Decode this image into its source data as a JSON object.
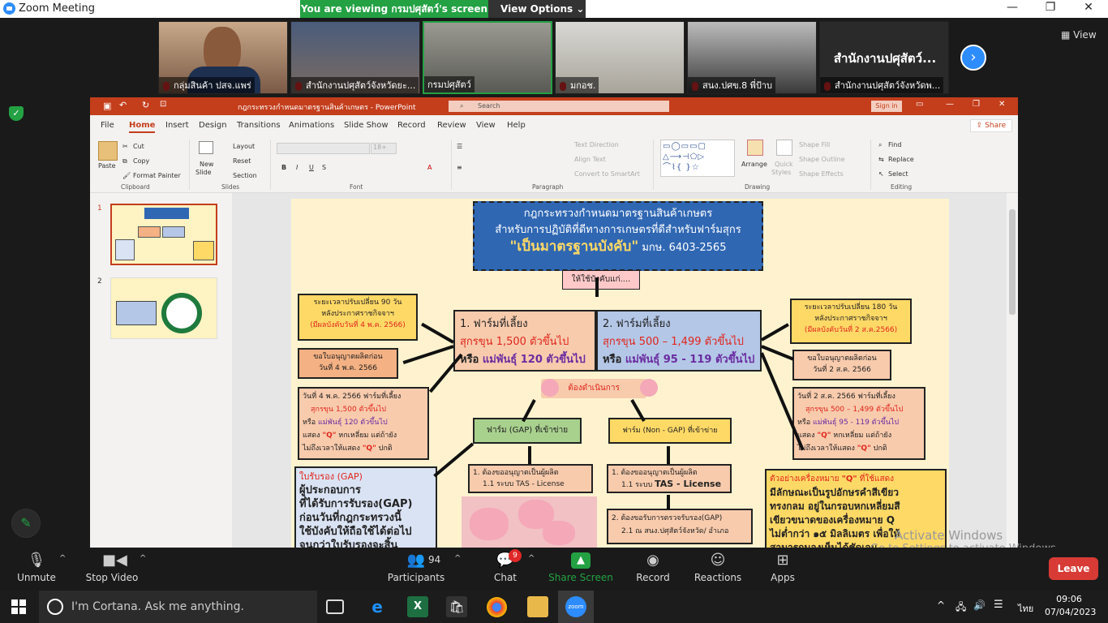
{
  "titlebar": {
    "title": "Zoom Meeting",
    "minimize": "—",
    "restore": "❐",
    "close": "✕"
  },
  "share_banner": {
    "viewing": "You are viewing กรมปศุสัตว์'s screen",
    "view_options": "View Options ⌄"
  },
  "gallery": {
    "participants": [
      {
        "name": "กลุ่มสินค้า ปสจ.แพร่"
      },
      {
        "name": "สำนักงานปศุสัตว์จังหวัดยะ..."
      },
      {
        "name": "กรมปศุสัตว์"
      },
      {
        "name": "มกอช."
      },
      {
        "name": "สนง.ปศข.8 พี่ป้าบ"
      },
      {
        "name": "สำนักงานปศุสัตว์จังหวัดพ..."
      }
    ],
    "big_name": "สำนักงานปศุสัตว์...",
    "view_label": "View",
    "next_icon": "›"
  },
  "ppt": {
    "doc_title": "กฎกระทรวงกำหนดมาตรฐานสินค้าเกษตร - PowerPoint",
    "search_placeholder": "Search",
    "sign_in": "Sign in",
    "tabs": [
      "File",
      "Home",
      "Insert",
      "Design",
      "Transitions",
      "Animations",
      "Slide Show",
      "Record",
      "Review",
      "View",
      "Help"
    ],
    "share": "Share",
    "ribbon": {
      "clipboard": {
        "paste": "Paste",
        "cut": "Cut",
        "copy": "Copy",
        "format_painter": "Format Painter",
        "label": "Clipboard"
      },
      "slides": {
        "new_slide": "New",
        "new_slide2": "Slide",
        "layout": "Layout",
        "reset": "Reset",
        "section": "Section",
        "label": "Slides"
      },
      "font": {
        "label": "Font",
        "size": "18+"
      },
      "paragraph": {
        "text_direction": "Text Direction",
        "align_text": "Align Text",
        "smartart": "Convert to SmartArt",
        "label": "Paragraph"
      },
      "drawing": {
        "arrange": "Arrange",
        "quick_styles": "Quick",
        "quick_styles2": "Styles",
        "shape_fill": "Shape Fill",
        "shape_outline": "Shape Outline",
        "shape_effects": "Shape Effects",
        "label": "Drawing"
      },
      "editing": {
        "find": "Find",
        "replace": "Replace",
        "select": "Select",
        "label": "Editing"
      }
    },
    "slide_numbers": [
      "1",
      "2"
    ]
  },
  "slide": {
    "title_l1": "กฎกระทรวงกำหนดมาตรฐานสินค้าเกษตร",
    "title_l2": "สำหรับการปฏิบัติที่ดีทางการเกษตรที่ดีสำหรับฟาร์มสุกร",
    "title_l3": "\"เป็นมาตรฐานบังคับ\"",
    "title_l3b": "มกษ. 6403-2565",
    "oblige": "ให้ใช้บังคับแก่....",
    "left_note1_l1": "ระยะเวลาปรับเปลี่ยน 90 วัน",
    "left_note1_l2": "หลังประกาศราชกิจจาฯ",
    "left_note1_l3": "(มีผลบังคับวันที่ 4 พ.ค. 2566)",
    "left_note2_l1": "ขอใบอนุญาตผลิตก่อน",
    "left_note2_l2": "วันที่ 4 พ.ค. 2566",
    "farm1_l1": "1. ฟาร์มที่เลี้ยง",
    "farm1_l2a": "สุกรขุน ",
    "farm1_l2b": "1,500 ตัวขึ้นไป",
    "farm1_l3a": "หรือ ",
    "farm1_l3b": "แม่พันธุ์ 120 ตัวขึ้นไป",
    "farm2_l1": "2. ฟาร์มที่เลี้ยง",
    "farm2_l2a": "สุกรขุน ",
    "farm2_l2b": "500 – 1,499 ตัวขึ้นไป",
    "farm2_l3a": "หรือ ",
    "farm2_l3b": "แม่พันธุ์ 95 - 119 ตัวขึ้นไป",
    "right_note1_l1": "ระยะเวลาปรับเปลี่ยน 180 วัน",
    "right_note1_l2": "หลังประกาศราชกิจจาฯ",
    "right_note1_l3": "(มีผลบังคับวันที่ 2 ส.ค.2566)",
    "right_note2_l1": "ขอใบอนุญาตผลิตก่อน",
    "right_note2_l2": "วันที่ 2 ส.ค. 2566",
    "must_do": "ต้องดำเนินการ",
    "left_note3_l1": "วันที่ 4 พ.ค. 2566 ฟาร์มที่เลี้ยง",
    "left_note3_l2": "สุกรขุน 1,500 ตัวขึ้นไป",
    "left_note3_l3a": "หรือ ",
    "left_note3_l3b": "แม่พันธุ์ 120 ตัวขึ้นไป",
    "left_note3_l4a": "แสดง ",
    "left_note3_l4b": "\"Q\"",
    "left_note3_l4c": " หกเหลี่ยม แต่ถ้ายัง",
    "left_note3_l5a": "ไม่ถึงเวลาให้แสดง ",
    "left_note3_l5b": "\"Q\"",
    "left_note3_l5c": " ปกติ",
    "gap_farm": "ฟาร์ม (GAP) ที่เข้าข่าย",
    "nongap_farm": "ฟาร์ม (Non - GAP) ที่เข้าข่าย",
    "right_note3_l1": "วันที่ 2 ส.ค. 2566 ฟาร์มที่เลี้ยง",
    "right_note3_l2": "สุกรขุน 500 – 1,499 ตัวขึ้นไป",
    "right_note3_l3a": "หรือ ",
    "right_note3_l3b": "แม่พันธุ์ 95 - 119 ตัวขึ้นไป",
    "right_note3_l4a": "แสดง ",
    "right_note3_l4b": "\"Q\"",
    "right_note3_l4c": " หกเหลี่ยม แต่ถ้ายัง",
    "right_note3_l5a": "ไม่ถึงเวลาให้แสดง ",
    "right_note3_l5b": "\"Q\"",
    "right_note3_l5c": " ปกติ",
    "gap_cert_title": "ใบรับรอง (GAP)",
    "gap_cert_l1": "ผู้ประกอบการ",
    "gap_cert_l2": "ที่ได้รับการรับรอง(GAP)",
    "gap_cert_l3": "ก่อนวันที่กฎกระทรวงนี้",
    "gap_cert_l4": "ใช้บังคับให้ถือใช้ได้ต่อไป",
    "gap_cert_l5": "จนกว่าใบรับรองจะสิ้น",
    "gap_step_l1": "1. ต้องขออนุญาตเป็นผู้ผลิต",
    "gap_step_l2": "1.1 ระบบ TAS - License",
    "nongap_step_l1": "1. ต้องขออนุญาตเป็นผู้ผลิต",
    "nongap_step_l2a": "1.1 ระบบ ",
    "nongap_step_l2b": "TAS - License",
    "nongap_step2_l1": "2. ต้องขอรับการตรวจรับรอง(GAP)",
    "nongap_step2_l2": "2.1 ณ สนง.ปศุสัตว์จังหวัด/ อำเภอ",
    "q_example_title_a": "ตัวอย่างเครื่องหมาย ",
    "q_example_title_b": "\"Q\"",
    "q_example_title_c": " ที่ใช้แสดง",
    "q_example_l1": "มีลักษณะเป็นรูปอักษรคำสีเขียว",
    "q_example_l2": "ทรงกลม อยู่ในกรอบหกเหลี่ยมสี",
    "q_example_l3": "เขียวขนาดของเครื่องหมาย Q",
    "q_example_l4": "ไม่ต่ำกว่า ๑๕ มิลลิเมตร เพื่อให้",
    "q_example_l5": "สามารถมองเห็นได้ชัดเจน"
  },
  "watermark": {
    "l1": "Activate Windows",
    "l2": "Go to Settings to activate Windows."
  },
  "controls": {
    "unmute": "Unmute",
    "stop_video": "Stop Video",
    "participants": "Participants",
    "participants_count": "94",
    "chat": "Chat",
    "chat_badge": "9",
    "share_screen": "Share Screen",
    "record": "Record",
    "reactions": "Reactions",
    "apps": "Apps",
    "leave": "Leave"
  },
  "taskbar": {
    "cortana": "I'm Cortana. Ask me anything.",
    "time": "09:06",
    "date": "07/04/2023",
    "lang": "ไทย"
  },
  "colors": {
    "zoom_green": "#23a143",
    "zoom_blue": "#2d8cff",
    "ppt_red": "#c43e1c",
    "leave_red": "#d83b35",
    "slide_bg": "#fff3cf"
  }
}
